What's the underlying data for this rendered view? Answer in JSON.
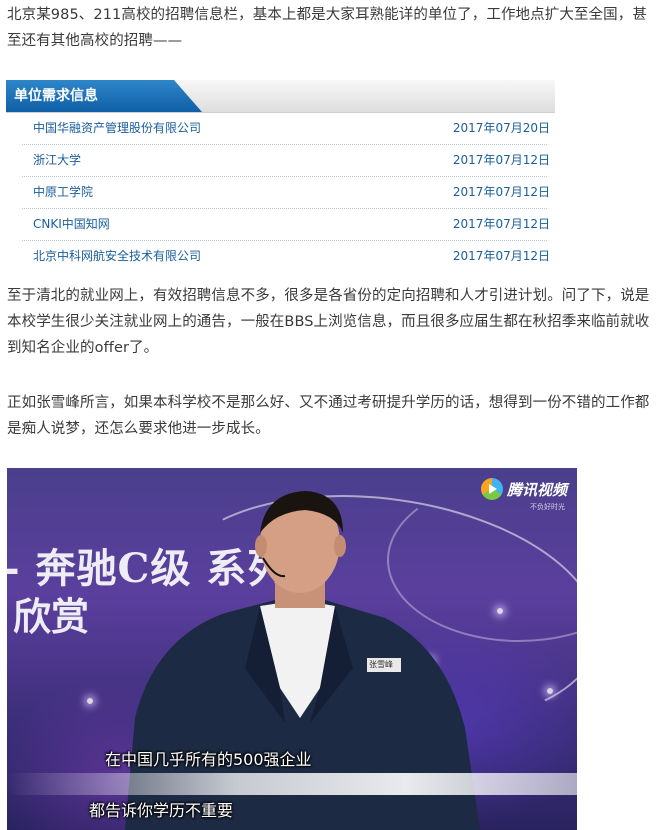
{
  "article": {
    "para1": "北京某985、211高校的招聘信息栏，基本上都是大家耳熟能详的单位了，工作地点扩大至全国，甚至还有其他高校的招聘——",
    "para2": "至于清北的就业网上，有效招聘信息不多，很多是各省份的定向招聘和人才引进计划。问了下，说是本校学生很少关注就业网上的通告，一般在BBS上浏览信息，而且很多应届生都在秋招季来临前就收到知名企业的offer了。",
    "para3": "正如张雪峰所言，如果本科学校不是那么好、又不通过考研提升学历的话，想得到一份不错的工作都是痴人说梦，还怎么要求他进一步成长。"
  },
  "widget": {
    "title": "单位需求信息",
    "accent_color": "#1a6fb8",
    "rows": [
      {
        "org": "中国华融资产管理股份有限公司",
        "date": "2017年07月20日"
      },
      {
        "org": "浙江大学",
        "date": "2017年07月12日"
      },
      {
        "org": "中原工学院",
        "date": "2017年07月12日"
      },
      {
        "org": "CNKI中国知网",
        "date": "2017年07月12日"
      },
      {
        "org": "北京中科网航安全技术有限公司",
        "date": "2017年07月12日"
      }
    ]
  },
  "video": {
    "logo_text": "腾讯视频",
    "logo_sub": "不负好时光",
    "bg_line1": "- 奔驰C级  系列",
    "bg_line2": "欣赏",
    "subtitle1": "在中国几乎所有的500强企业",
    "subtitle2": "都告诉你学历不重要",
    "name_badge": "张雪峰"
  }
}
